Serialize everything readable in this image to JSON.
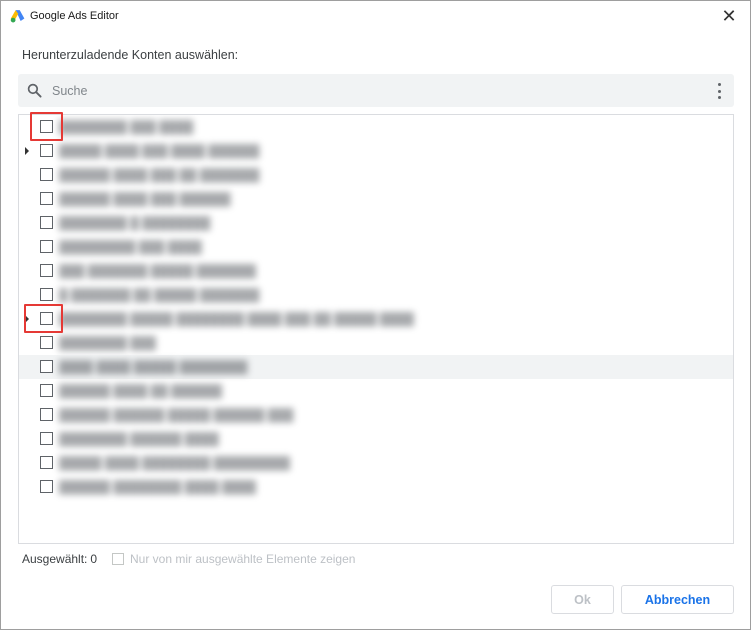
{
  "window": {
    "title": "Google Ads Editor",
    "icons": {
      "app": "google-ads-logo-icon",
      "close": "close-icon"
    },
    "close_glyph": "✕"
  },
  "dialog": {
    "prompt": "Herunterzuladende Konten auswählen:",
    "search": {
      "placeholder": "Suche",
      "value": "",
      "icon": "search-icon",
      "menu_icon": "more-vert-icon"
    },
    "accounts": [
      {
        "label": "████████ ███ ████",
        "expandable": false,
        "checked": false,
        "highlighted": true
      },
      {
        "label": "█████ ████ ███ ████ ██████",
        "expandable": true,
        "checked": false,
        "highlighted": false
      },
      {
        "label": "██████ ████ ███ ██ ███████",
        "expandable": false,
        "checked": false,
        "highlighted": false
      },
      {
        "label": "██████ ████ ███ ██████",
        "expandable": false,
        "checked": false,
        "highlighted": false
      },
      {
        "label": "████████ █ ████████",
        "expandable": false,
        "checked": false,
        "highlighted": false
      },
      {
        "label": "█████████ ███ ████",
        "expandable": false,
        "checked": false,
        "highlighted": false
      },
      {
        "label": "███ ███████ █████ ███████",
        "expandable": false,
        "checked": false,
        "highlighted": false
      },
      {
        "label": "█ ███████ ██ █████ ███████",
        "expandable": false,
        "checked": false,
        "highlighted": false
      },
      {
        "label": "████████ █████ ████████ ████ ███ ██ █████ ████",
        "expandable": true,
        "checked": false,
        "highlighted": true
      },
      {
        "label": "████████ ███",
        "expandable": false,
        "checked": false,
        "highlighted": false
      },
      {
        "label": "████ ████ █████ ████████",
        "expandable": false,
        "checked": false,
        "highlighted": false
      },
      {
        "label": "██████ ████ ██ ██████",
        "expandable": false,
        "checked": false,
        "highlighted": false
      },
      {
        "label": "██████ ██████ █████ ██████ ███",
        "expandable": false,
        "checked": false,
        "highlighted": false
      },
      {
        "label": "████████ ██████ ████",
        "expandable": false,
        "checked": false,
        "highlighted": false
      },
      {
        "label": "█████ ████ ████████ █████████",
        "expandable": false,
        "checked": false,
        "highlighted": false
      },
      {
        "label": "██████ ████████ ████ ████",
        "expandable": false,
        "checked": false,
        "highlighted": false
      }
    ],
    "hovered_row_index": 10,
    "selected_count_label": "Ausgewählt:",
    "selected_count": "0",
    "show_selected_only_label": "Nur von mir ausgewählte Elemente zeigen",
    "show_selected_only_checked": false,
    "buttons": {
      "ok": "Ok",
      "cancel": "Abbrechen"
    }
  },
  "colors": {
    "accent": "#1a73e8",
    "highlight_annotation": "#e53935",
    "disabled_text": "#bdc1c6",
    "search_bg": "#f1f3f4"
  }
}
